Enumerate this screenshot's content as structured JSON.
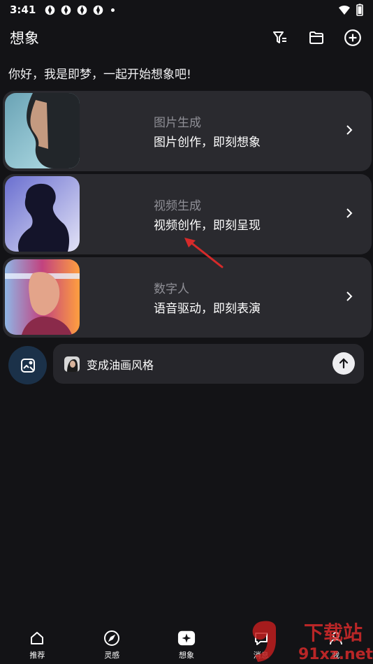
{
  "status_bar": {
    "time": "3:41",
    "icons": [
      "app-notification-icon",
      "app-notification-icon",
      "app-notification-icon",
      "app-notification-icon",
      "more-dot-icon"
    ],
    "right_icons": [
      "wifi-icon",
      "battery-icon"
    ]
  },
  "app_bar": {
    "title": "想象",
    "actions": [
      "filter-icon",
      "folder-icon",
      "add-circle-icon"
    ]
  },
  "greeting": "你好，我是即梦，一起开始想象吧!",
  "cards": [
    {
      "title": "图片生成",
      "subtitle": "图片创作，即刻想象",
      "thumb_colors": [
        "#5e93a6",
        "#b6dde6"
      ]
    },
    {
      "title": "视频生成",
      "subtitle": "视频创作，即刻呈现",
      "thumb_colors": [
        "#3a3a7a",
        "#d2d4f2"
      ]
    },
    {
      "title": "数字人",
      "subtitle": "语音驱动，即刻表演",
      "thumb_colors": [
        "#c8417e",
        "#ff9f3f"
      ]
    }
  ],
  "prompt": {
    "text": "变成油画风格",
    "avatar_icon": "image-edit-icon",
    "send_icon": "arrow-up-icon"
  },
  "bottom_nav": [
    {
      "label": "推荐",
      "icon": "home-icon"
    },
    {
      "label": "灵感",
      "icon": "compass-icon"
    },
    {
      "label": "想象",
      "icon": "sparkle-icon"
    },
    {
      "label": "消息",
      "icon": "message-icon"
    },
    {
      "label": "我",
      "icon": "profile-icon"
    }
  ],
  "watermark": {
    "line1": "下载站",
    "line2": "91xz.net"
  },
  "colors": {
    "background": "#131316",
    "card": "#2a2a2f",
    "accent_red": "#d62a2a"
  }
}
